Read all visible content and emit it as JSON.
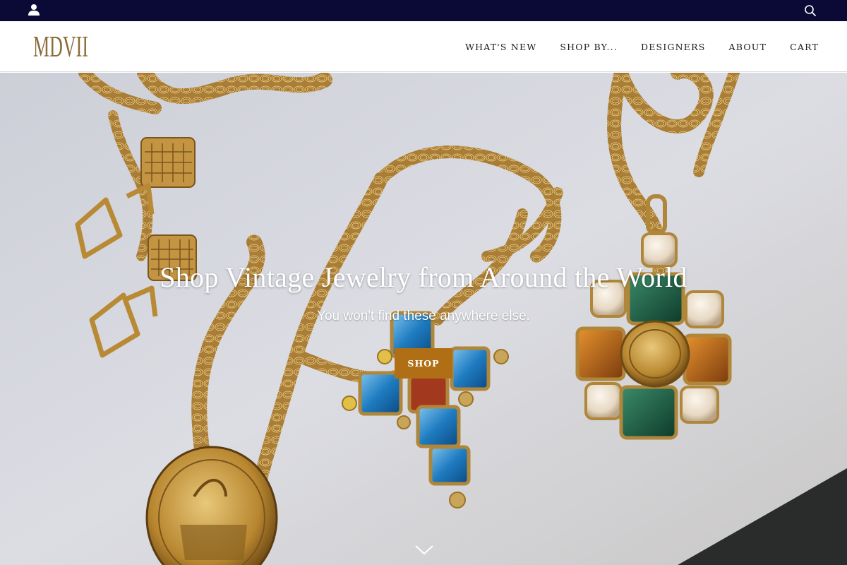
{
  "topbar": {
    "background": "#0b0a37",
    "account_icon": "user-icon",
    "search_icon": "search-icon"
  },
  "header": {
    "logo_text": "MDVII",
    "logo_color": "#8b6b3a",
    "nav": [
      {
        "label": "WHAT'S NEW"
      },
      {
        "label": "SHOP BY..."
      },
      {
        "label": "DESIGNERS"
      },
      {
        "label": "ABOUT"
      },
      {
        "label": "CART"
      }
    ]
  },
  "hero": {
    "title": "Shop Vintage Jewelry from Around the World",
    "subtitle": "You won't find these anywhere else.",
    "cta_label": "SHOP",
    "cta_color": "#b06f14",
    "scroll_icon": "chevron-down-icon"
  }
}
